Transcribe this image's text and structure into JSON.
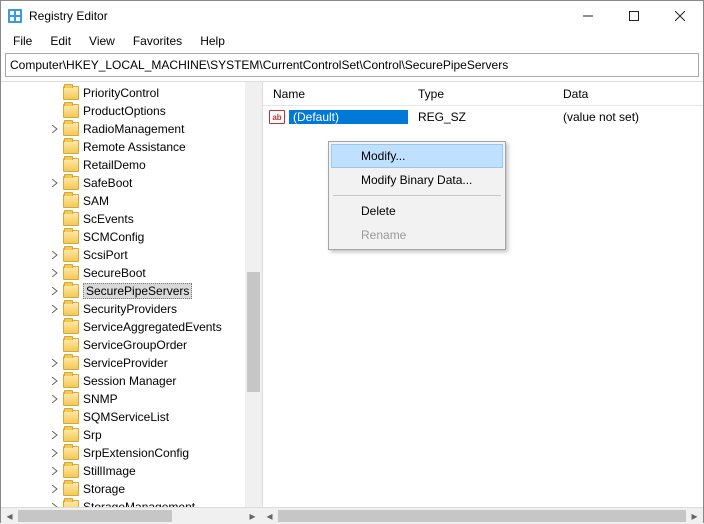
{
  "window": {
    "title": "Registry Editor"
  },
  "menu": {
    "file": "File",
    "edit": "Edit",
    "view": "View",
    "favorites": "Favorites",
    "help": "Help"
  },
  "address": {
    "path": "Computer\\HKEY_LOCAL_MACHINE\\SYSTEM\\CurrentControlSet\\Control\\SecurePipeServers"
  },
  "tree": {
    "items": [
      {
        "label": "PriorityControl",
        "expand": "none"
      },
      {
        "label": "ProductOptions",
        "expand": "none"
      },
      {
        "label": "RadioManagement",
        "expand": "closed"
      },
      {
        "label": "Remote Assistance",
        "expand": "none"
      },
      {
        "label": "RetailDemo",
        "expand": "none"
      },
      {
        "label": "SafeBoot",
        "expand": "closed"
      },
      {
        "label": "SAM",
        "expand": "none"
      },
      {
        "label": "ScEvents",
        "expand": "none"
      },
      {
        "label": "SCMConfig",
        "expand": "none"
      },
      {
        "label": "ScsiPort",
        "expand": "closed"
      },
      {
        "label": "SecureBoot",
        "expand": "closed"
      },
      {
        "label": "SecurePipeServers",
        "expand": "closed",
        "selected": true
      },
      {
        "label": "SecurityProviders",
        "expand": "closed"
      },
      {
        "label": "ServiceAggregatedEvents",
        "expand": "none"
      },
      {
        "label": "ServiceGroupOrder",
        "expand": "none"
      },
      {
        "label": "ServiceProvider",
        "expand": "closed"
      },
      {
        "label": "Session Manager",
        "expand": "closed"
      },
      {
        "label": "SNMP",
        "expand": "closed"
      },
      {
        "label": "SQMServiceList",
        "expand": "none"
      },
      {
        "label": "Srp",
        "expand": "closed"
      },
      {
        "label": "SrpExtensionConfig",
        "expand": "closed"
      },
      {
        "label": "StillImage",
        "expand": "closed"
      },
      {
        "label": "Storage",
        "expand": "closed"
      },
      {
        "label": "StorageManagement",
        "expand": "closed"
      }
    ]
  },
  "columns": {
    "name": "Name",
    "type": "Type",
    "data": "Data"
  },
  "value_row": {
    "icon": "ab",
    "name": "(Default)",
    "type": "REG_SZ",
    "data": "(value not set)"
  },
  "context": {
    "modify": "Modify...",
    "modify_binary": "Modify Binary Data...",
    "delete": "Delete",
    "rename": "Rename"
  }
}
